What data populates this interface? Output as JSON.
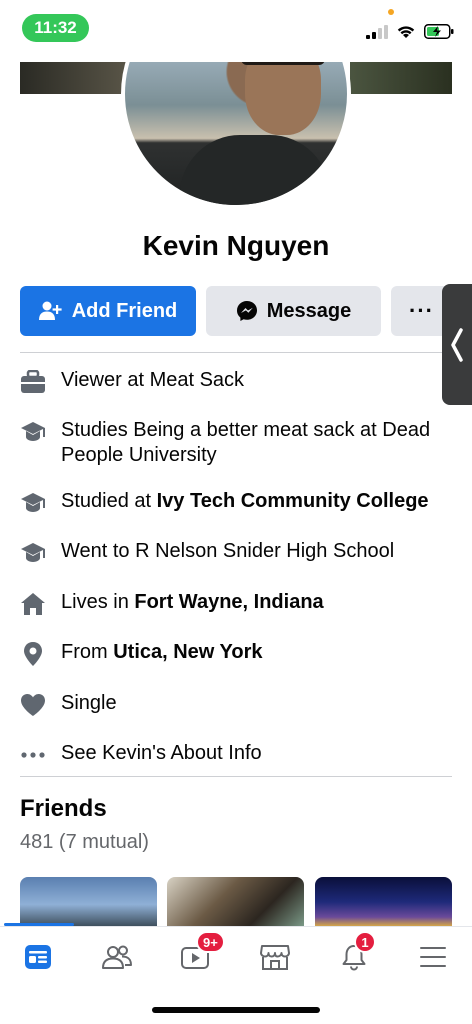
{
  "status_bar": {
    "time": "11:32"
  },
  "profile": {
    "name": "Kevin Nguyen",
    "add_friend_label": "Add Friend",
    "message_label": "Message",
    "more_label": "···"
  },
  "info": [
    {
      "icon": "briefcase-icon",
      "text": "Viewer at Meat Sack"
    },
    {
      "icon": "graduation-cap-icon",
      "text": "Studies Being a better meat sack at Dead People University"
    },
    {
      "icon": "graduation-cap-icon",
      "prefix": "Studied at ",
      "bold": "Ivy Tech Community College"
    },
    {
      "icon": "graduation-cap-icon",
      "text": "Went to R Nelson Snider High School"
    },
    {
      "icon": "house-icon",
      "prefix": "Lives in ",
      "bold": "Fort Wayne, Indiana"
    },
    {
      "icon": "location-pin-icon",
      "prefix": "From ",
      "bold": "Utica, New York"
    },
    {
      "icon": "heart-icon",
      "text": "Single"
    },
    {
      "icon": "ellipsis-icon",
      "text": "See Kevin's About Info"
    }
  ],
  "friends": {
    "title": "Friends",
    "count": "481 (7 mutual)"
  },
  "tabbar": {
    "watch_badge": "9+",
    "notifications_badge": "1"
  },
  "colors": {
    "accent": "#1b74e4",
    "badge": "#e41e3f",
    "status_pill": "#34c759"
  }
}
